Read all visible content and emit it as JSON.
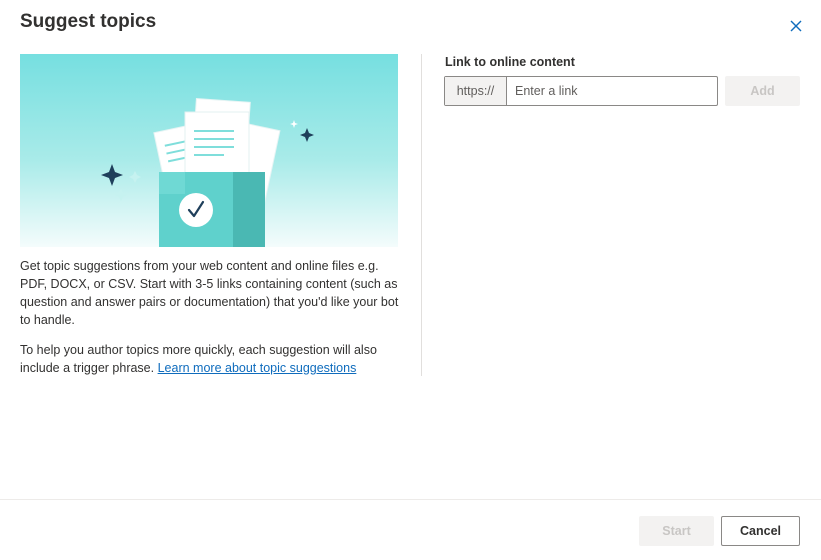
{
  "dialog": {
    "title": "Suggest topics",
    "close_icon": "close-icon"
  },
  "left": {
    "description": "Get topic suggestions from your web content and online files e.g. PDF, DOCX, or CSV. Start with 3-5 links containing content (such as question and answer pairs or documentation) that you'd like your bot to handle.",
    "help_text": "To help you author topics more quickly, each suggestion will also include a trigger phrase. ",
    "learn_more_link": "Learn more about topic suggestions",
    "illustration_icon": "documents-box-checkmark-illustration"
  },
  "right": {
    "field_label": "Link to online content",
    "prefix": "https://",
    "input_value": "",
    "input_placeholder": "Enter a link",
    "add_label": "Add"
  },
  "footer": {
    "start_label": "Start",
    "cancel_label": "Cancel"
  },
  "colors": {
    "accent": "#0f6cbd",
    "teal_light": "#76dfe0",
    "teal_box": "#5fd1cc",
    "dark_sparkle": "#1f3f5b"
  }
}
